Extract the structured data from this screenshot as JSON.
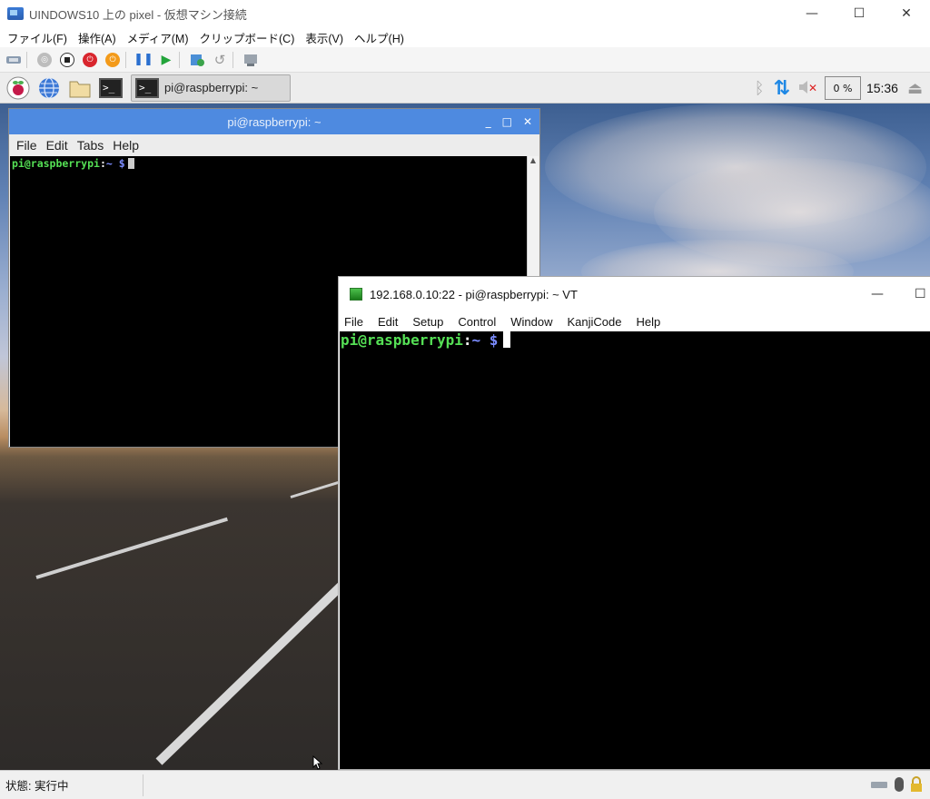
{
  "host": {
    "title": "UINDOWS10 上の pixel - 仮想マシン接続",
    "menu": [
      "ファイル(F)",
      "操作(A)",
      "メディア(M)",
      "クリップボード(C)",
      "表示(V)",
      "ヘルプ(H)"
    ],
    "status": "状態: 実行中",
    "controls": {
      "minimize": "—",
      "maximize": "☐",
      "close": "✕"
    }
  },
  "panel": {
    "task_label": "pi@raspberrypi: ~",
    "cpu": "0 %",
    "clock": "15:36"
  },
  "pi_terminal": {
    "title": "pi@raspberrypi: ~",
    "menu": [
      "File",
      "Edit",
      "Tabs",
      "Help"
    ],
    "prompt_user": "pi@raspberrypi",
    "prompt_sep": ":",
    "prompt_dir": "~ $",
    "controls": {
      "minimize": "_",
      "maximize": "□",
      "close": "✕"
    }
  },
  "vt_terminal": {
    "title": "192.168.0.10:22 - pi@raspberrypi: ~ VT",
    "menu": [
      "File",
      "Edit",
      "Setup",
      "Control",
      "Window",
      "KanjiCode",
      "Help"
    ],
    "prompt_user": "pi@raspberrypi",
    "prompt_sep": ":",
    "prompt_dir": "~ $",
    "controls": {
      "minimize": "—",
      "maximize": "☐"
    }
  }
}
